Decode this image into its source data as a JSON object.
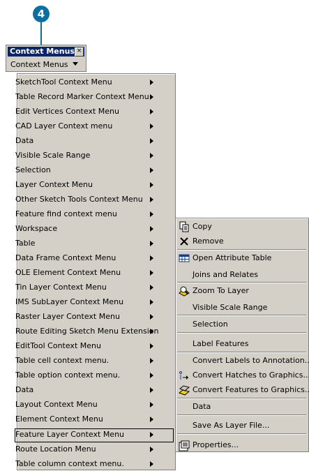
{
  "callout": {
    "number": "4"
  },
  "toolbar": {
    "title": "Context Menus",
    "close_glyph": "☒",
    "button_label": "Context Menus"
  },
  "menu": {
    "items": [
      "SketchTool Context Menu",
      "Table Record Marker Context Menu.",
      "Edit Vertices Context Menu",
      "CAD Layer Context menu",
      "Data",
      "Visible Scale Range",
      "Selection",
      "Layer Context Menu",
      "Other Sketch Tools Context Menu",
      "Feature find context menu",
      "Workspace",
      "Table",
      "Data Frame Context Menu",
      "OLE Element Context Menu",
      "Tin Layer Context Menu",
      "IMS SubLayer Context Menu",
      "Raster Layer Context Menu",
      "Route Editing Sketch Menu Extension",
      "EditTool Context Menu",
      "Table cell context menu.",
      "Table option context menu.",
      "Data",
      "Layout Context Menu",
      "Element Context Menu",
      "Feature Layer Context Menu",
      "Route Location Menu",
      "Table column context menu."
    ],
    "selected_index": 24
  },
  "submenu": {
    "items": [
      {
        "label": "Copy",
        "icon": "copy-icon"
      },
      {
        "label": "Remove",
        "icon": "remove-icon"
      },
      {
        "label": "Open Attribute Table",
        "icon": "table-icon"
      },
      {
        "label": "Joins and Relates",
        "icon": ""
      },
      {
        "label": "Zoom To Layer",
        "icon": "zoom-to-layer-icon"
      },
      {
        "label": "Visible Scale Range",
        "icon": ""
      },
      {
        "label": "Selection",
        "icon": ""
      },
      {
        "label": "Label Features",
        "icon": ""
      },
      {
        "label": "Convert Labels to Annotation...",
        "icon": ""
      },
      {
        "label": "Convert Hatches to Graphics...",
        "icon": "convert-hatches-icon"
      },
      {
        "label": "Convert Features to Graphics...",
        "icon": "convert-features-icon"
      },
      {
        "label": "Data",
        "icon": ""
      },
      {
        "label": "Save As Layer File...",
        "icon": ""
      },
      {
        "label": "Properties...",
        "icon": "properties-icon"
      }
    ]
  },
  "colors": {
    "menu_bg": "#d4d0c8",
    "title_bg": "#0a246a",
    "callout": "#0d6ea0"
  }
}
